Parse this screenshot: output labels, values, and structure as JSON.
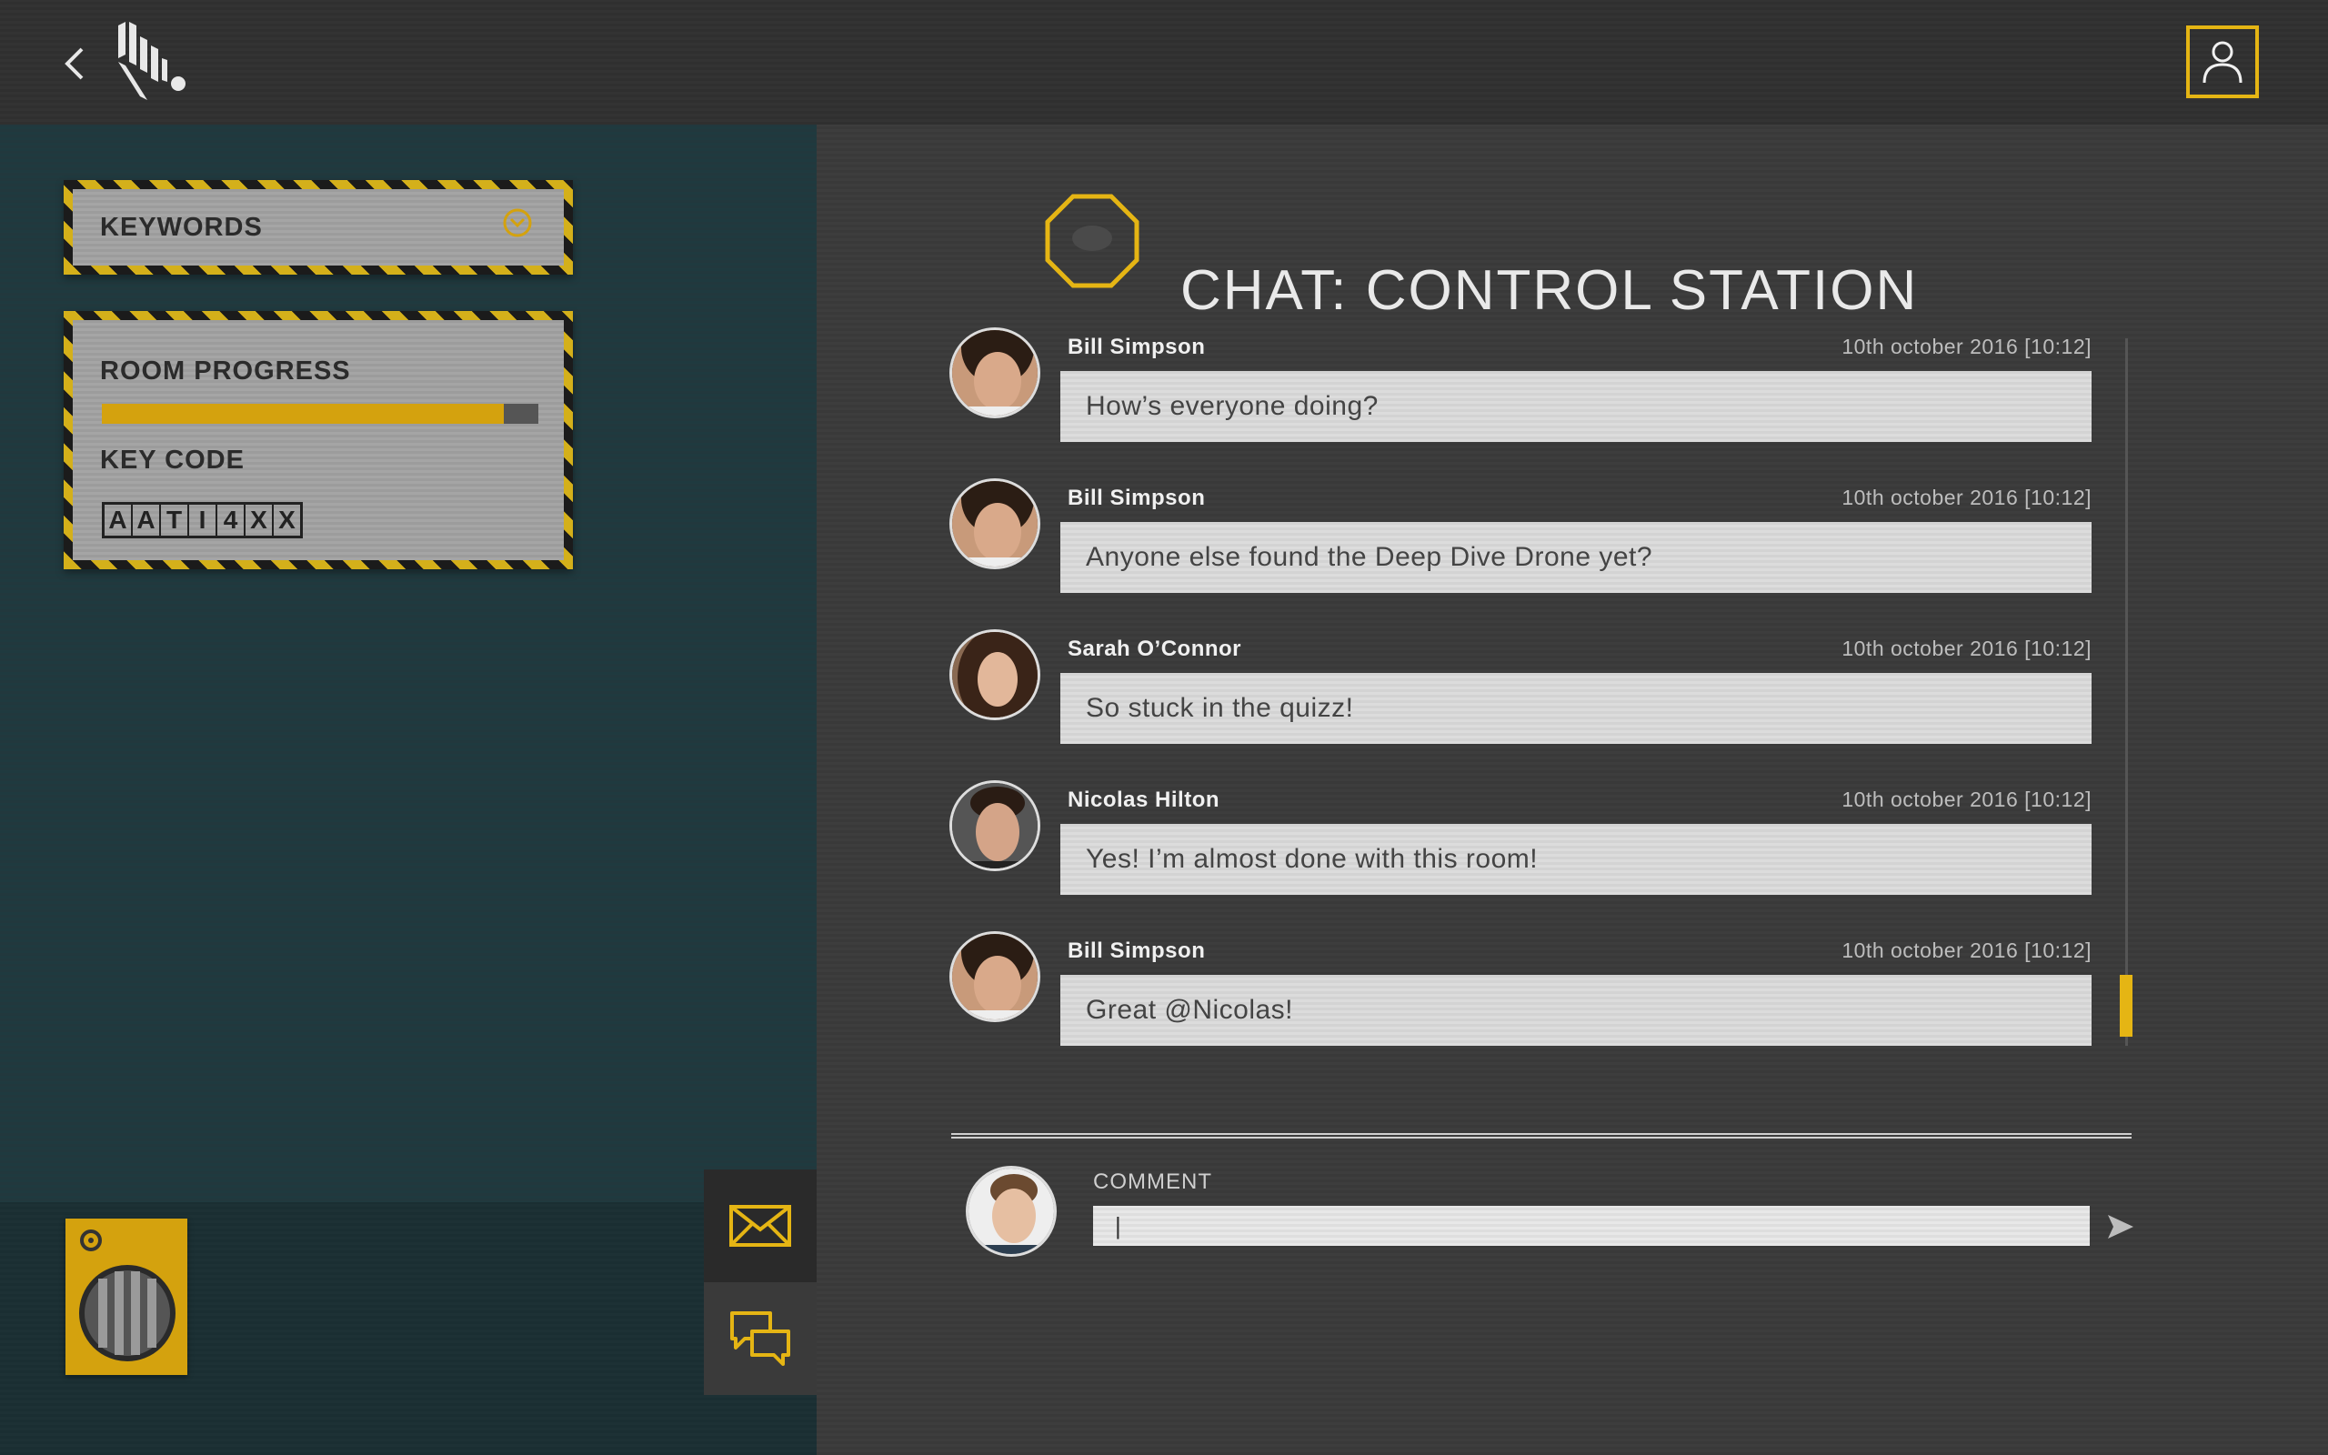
{
  "header": {
    "back_icon": "chevron-left-icon",
    "logo_icon": "zebra-logo-icon",
    "profile_icon": "user-icon"
  },
  "sidebar": {
    "keywords_label": "KEYWORDS",
    "room_progress_label": "ROOM PROGRESS",
    "room_progress_value": 0.92,
    "key_code_label": "KEY CODE",
    "key_code": [
      "A",
      "A",
      "T",
      "I",
      "4",
      "X",
      "X"
    ]
  },
  "tools": {
    "mail_icon": "envelope-icon",
    "chat_icon": "chat-bubbles-icon",
    "device_icon": "radio-device-icon"
  },
  "chat": {
    "title": "CHAT: CONTROL STATION",
    "messages": [
      {
        "author": "Bill Simpson",
        "time": "10th october 2016 [10:12]",
        "text": "How’s everyone doing?"
      },
      {
        "author": "Bill Simpson",
        "time": "10th october 2016 [10:12]",
        "text": "Anyone else found the Deep Dive Drone yet?"
      },
      {
        "author": "Sarah O’Connor",
        "time": "10th october 2016 [10:12]",
        "text": "So stuck in the quizz!"
      },
      {
        "author": "Nicolas Hilton",
        "time": "10th october 2016 [10:12]",
        "text": "Yes! I’m almost done with this room!"
      },
      {
        "author": "Bill Simpson",
        "time": "10th october 2016 [10:12]",
        "text": "Great @Nicolas!"
      }
    ],
    "comment_label": "COMMENT",
    "comment_value": "|"
  },
  "colors": {
    "accent": "#e5b514",
    "sidebar_bg": "#1f3a3f",
    "main_bg": "#3a3a3a"
  }
}
